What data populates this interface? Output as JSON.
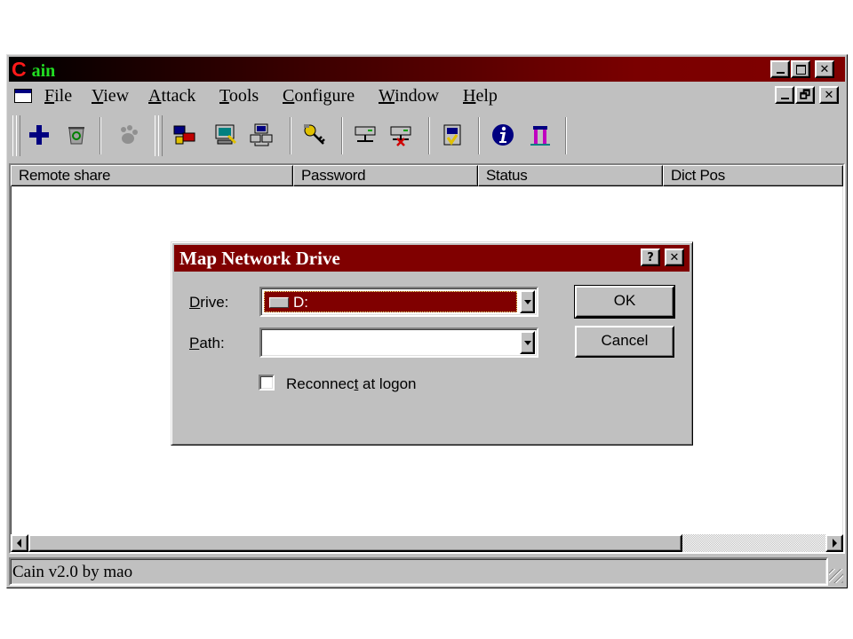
{
  "app": {
    "title_c": "C",
    "title_rest": "ain"
  },
  "menu": {
    "items": [
      {
        "mnemonic": "F",
        "rest": "ile"
      },
      {
        "mnemonic": "V",
        "rest": "iew"
      },
      {
        "mnemonic": "A",
        "rest": "ttack"
      },
      {
        "mnemonic": "T",
        "rest": "ools"
      },
      {
        "mnemonic": "C",
        "rest": "onfigure"
      },
      {
        "mnemonic": "W",
        "rest": "indow"
      },
      {
        "mnemonic": "H",
        "rest": "elp"
      }
    ]
  },
  "list": {
    "columns": [
      "Remote share",
      "Password",
      "Status",
      "Dict Pos"
    ]
  },
  "status": {
    "text": "Cain v2.0 by mao"
  },
  "dialog": {
    "title": "Map Network Drive",
    "drive_label_mnemonic": "D",
    "drive_label_rest": "rive:",
    "drive_value": "D:",
    "path_label_mnemonic": "P",
    "path_label_rest": "ath:",
    "path_value": "",
    "ok_label": "OK",
    "cancel_label": "Cancel",
    "reconnect_pre": "Reconnec",
    "reconnect_mnemonic": "t",
    "reconnect_post": " at logon",
    "reconnect_checked": false
  },
  "colors": {
    "titlebar": "#800000",
    "face": "#c0c0c0",
    "title_c": "#ff1a1a",
    "title_rest": "#22dd22"
  },
  "icons": [
    "add-icon",
    "recycle-icon",
    "paw-icon",
    "network-scan-icon",
    "computer-icon",
    "network-computers-icon",
    "key-icon",
    "map-drive-icon",
    "disconnect-drive-icon",
    "dictionary-icon",
    "info-icon",
    "exit-icon"
  ]
}
